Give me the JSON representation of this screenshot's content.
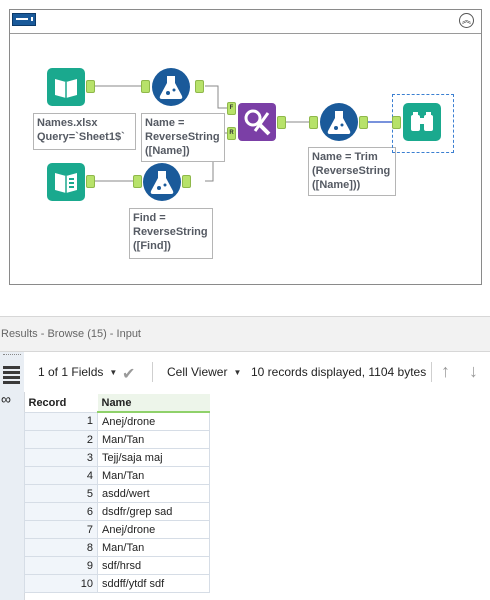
{
  "workflow": {
    "tools": {
      "input1": {
        "icon": "book-icon",
        "annotation": [
          "Names.xlsx",
          "Query=`Sheet1$`"
        ]
      },
      "formula1": {
        "icon": "flask-icon",
        "annotation": [
          "Name =",
          "ReverseString",
          "([Name])"
        ]
      },
      "input2": {
        "icon": "list-book-icon"
      },
      "formula2": {
        "icon": "flask-icon",
        "annotation": [
          "Find =",
          "ReverseString",
          "([Find])"
        ]
      },
      "join": {
        "icon": "find-replace-icon",
        "anchor_f": "F",
        "anchor_r": "R"
      },
      "formula3": {
        "icon": "flask-icon",
        "annotation": [
          "Name = Trim",
          "(ReverseString",
          "([Name]))"
        ]
      },
      "browse": {
        "icon": "binoculars-icon"
      }
    },
    "colors": {
      "input": "#1aa98e",
      "formula": "#1a5a9a",
      "join": "#7b3fa6",
      "anchor": "#b7e26a"
    }
  },
  "results": {
    "title": "Results - Browse (15) - Input",
    "toolbar": {
      "fields_selector": "1 of 1 Fields",
      "viewer_selector": "Cell Viewer",
      "records_info": "10 records displayed, 1104 bytes"
    },
    "grid": {
      "headers": {
        "record": "Record",
        "name": "Name"
      },
      "rows": [
        {
          "record": "1",
          "name": "Anej/drone"
        },
        {
          "record": "2",
          "name": "Man/Tan"
        },
        {
          "record": "3",
          "name": "Tejj/saja maj"
        },
        {
          "record": "4",
          "name": "Man/Tan"
        },
        {
          "record": "5",
          "name": "asdd/wert"
        },
        {
          "record": "6",
          "name": "dsdfr/grep sad"
        },
        {
          "record": "7",
          "name": "Anej/drone"
        },
        {
          "record": "8",
          "name": "Man/Tan"
        },
        {
          "record": "9",
          "name": "sdf/hrsd"
        },
        {
          "record": "10",
          "name": "sddff/ytdf sdf"
        }
      ]
    }
  }
}
